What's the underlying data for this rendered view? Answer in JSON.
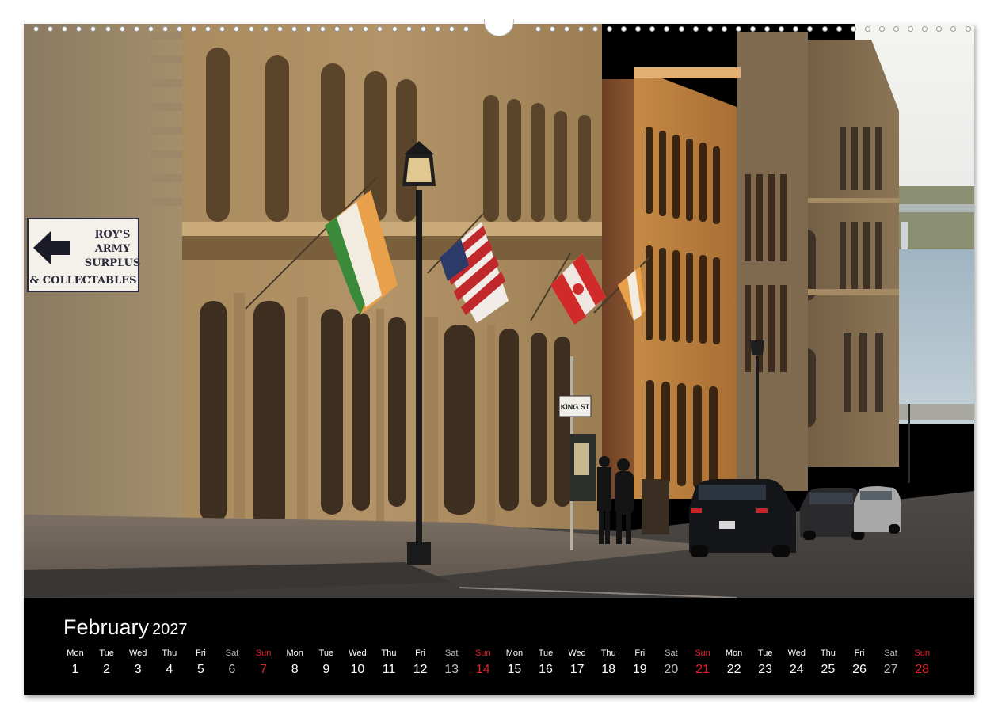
{
  "shop_sign": {
    "lines": [
      "ROY'S",
      "ARMY",
      "SURPLUS",
      "& COLLECTABLES"
    ]
  },
  "street_sign": {
    "text": "KING ST"
  },
  "calendar": {
    "month": "February",
    "year": "2027",
    "days": [
      {
        "dow": "Mon",
        "num": "1",
        "kind": "week"
      },
      {
        "dow": "Tue",
        "num": "2",
        "kind": "week"
      },
      {
        "dow": "Wed",
        "num": "3",
        "kind": "week"
      },
      {
        "dow": "Thu",
        "num": "4",
        "kind": "week"
      },
      {
        "dow": "Fri",
        "num": "5",
        "kind": "week"
      },
      {
        "dow": "Sat",
        "num": "6",
        "kind": "sat"
      },
      {
        "dow": "Sun",
        "num": "7",
        "kind": "sun"
      },
      {
        "dow": "Mon",
        "num": "8",
        "kind": "week"
      },
      {
        "dow": "Tue",
        "num": "9",
        "kind": "week"
      },
      {
        "dow": "Wed",
        "num": "10",
        "kind": "week"
      },
      {
        "dow": "Thu",
        "num": "11",
        "kind": "week"
      },
      {
        "dow": "Fri",
        "num": "12",
        "kind": "week"
      },
      {
        "dow": "Sat",
        "num": "13",
        "kind": "sat"
      },
      {
        "dow": "Sun",
        "num": "14",
        "kind": "sun"
      },
      {
        "dow": "Mon",
        "num": "15",
        "kind": "week"
      },
      {
        "dow": "Tue",
        "num": "16",
        "kind": "week"
      },
      {
        "dow": "Wed",
        "num": "17",
        "kind": "week"
      },
      {
        "dow": "Thu",
        "num": "18",
        "kind": "week"
      },
      {
        "dow": "Fri",
        "num": "19",
        "kind": "week"
      },
      {
        "dow": "Sat",
        "num": "20",
        "kind": "sat"
      },
      {
        "dow": "Sun",
        "num": "21",
        "kind": "sun"
      },
      {
        "dow": "Mon",
        "num": "22",
        "kind": "week"
      },
      {
        "dow": "Tue",
        "num": "23",
        "kind": "week"
      },
      {
        "dow": "Wed",
        "num": "24",
        "kind": "week"
      },
      {
        "dow": "Thu",
        "num": "25",
        "kind": "week"
      },
      {
        "dow": "Fri",
        "num": "26",
        "kind": "week"
      },
      {
        "dow": "Sat",
        "num": "27",
        "kind": "sat"
      },
      {
        "dow": "Sun",
        "num": "28",
        "kind": "sun"
      }
    ]
  },
  "colors": {
    "weekday": "#ffffff",
    "saturday": "#bdbdbd",
    "sunday": "#e8202a",
    "strip": "#000000"
  }
}
